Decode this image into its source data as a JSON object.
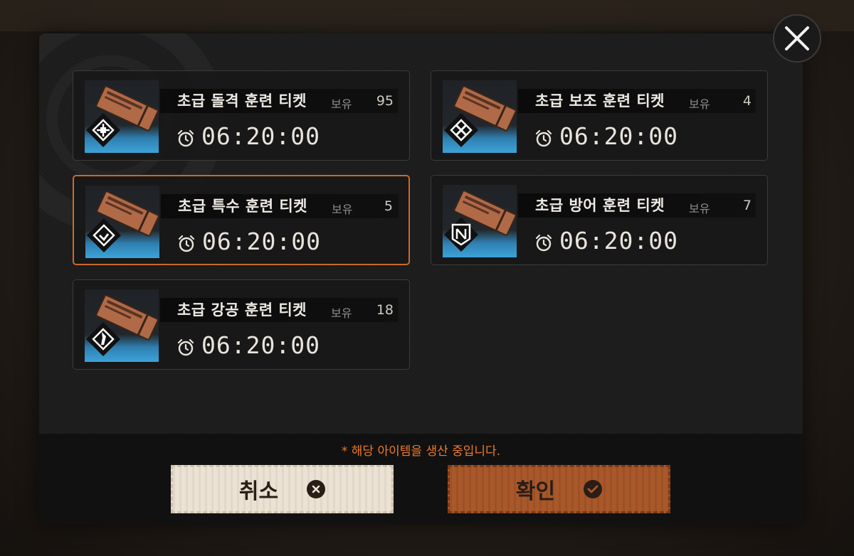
{
  "dialog": {
    "tickets": [
      {
        "name": "초급 돌격 훈련 티켓",
        "owned_label": "보유",
        "owned_count": "95",
        "timer": "06:20:00",
        "class_icon": "assault-class-icon",
        "selected": false
      },
      {
        "name": "초급 보조 훈련 티켓",
        "owned_label": "보유",
        "owned_count": "4",
        "timer": "06:20:00",
        "class_icon": "support-class-icon",
        "selected": false
      },
      {
        "name": "초급 특수 훈련 티켓",
        "owned_label": "보유",
        "owned_count": "5",
        "timer": "06:20:00",
        "class_icon": "special-class-icon",
        "selected": true
      },
      {
        "name": "초급 방어 훈련 티켓",
        "owned_label": "보유",
        "owned_count": "7",
        "timer": "06:20:00",
        "class_icon": "defense-class-icon",
        "selected": false
      },
      {
        "name": "초급 강공 훈련 티켓",
        "owned_label": "보유",
        "owned_count": "18",
        "timer": "06:20:00",
        "class_icon": "strike-class-icon",
        "selected": false
      }
    ],
    "notice": "* 해당 아이템을 생산 중입니다.",
    "cancel_label": "취소",
    "confirm_label": "확인"
  },
  "colors": {
    "accent": "#c96a2c",
    "notice": "#ee7a2c",
    "cancel_bg": "#ece2d4",
    "confirm_bg": "#a9582a"
  }
}
